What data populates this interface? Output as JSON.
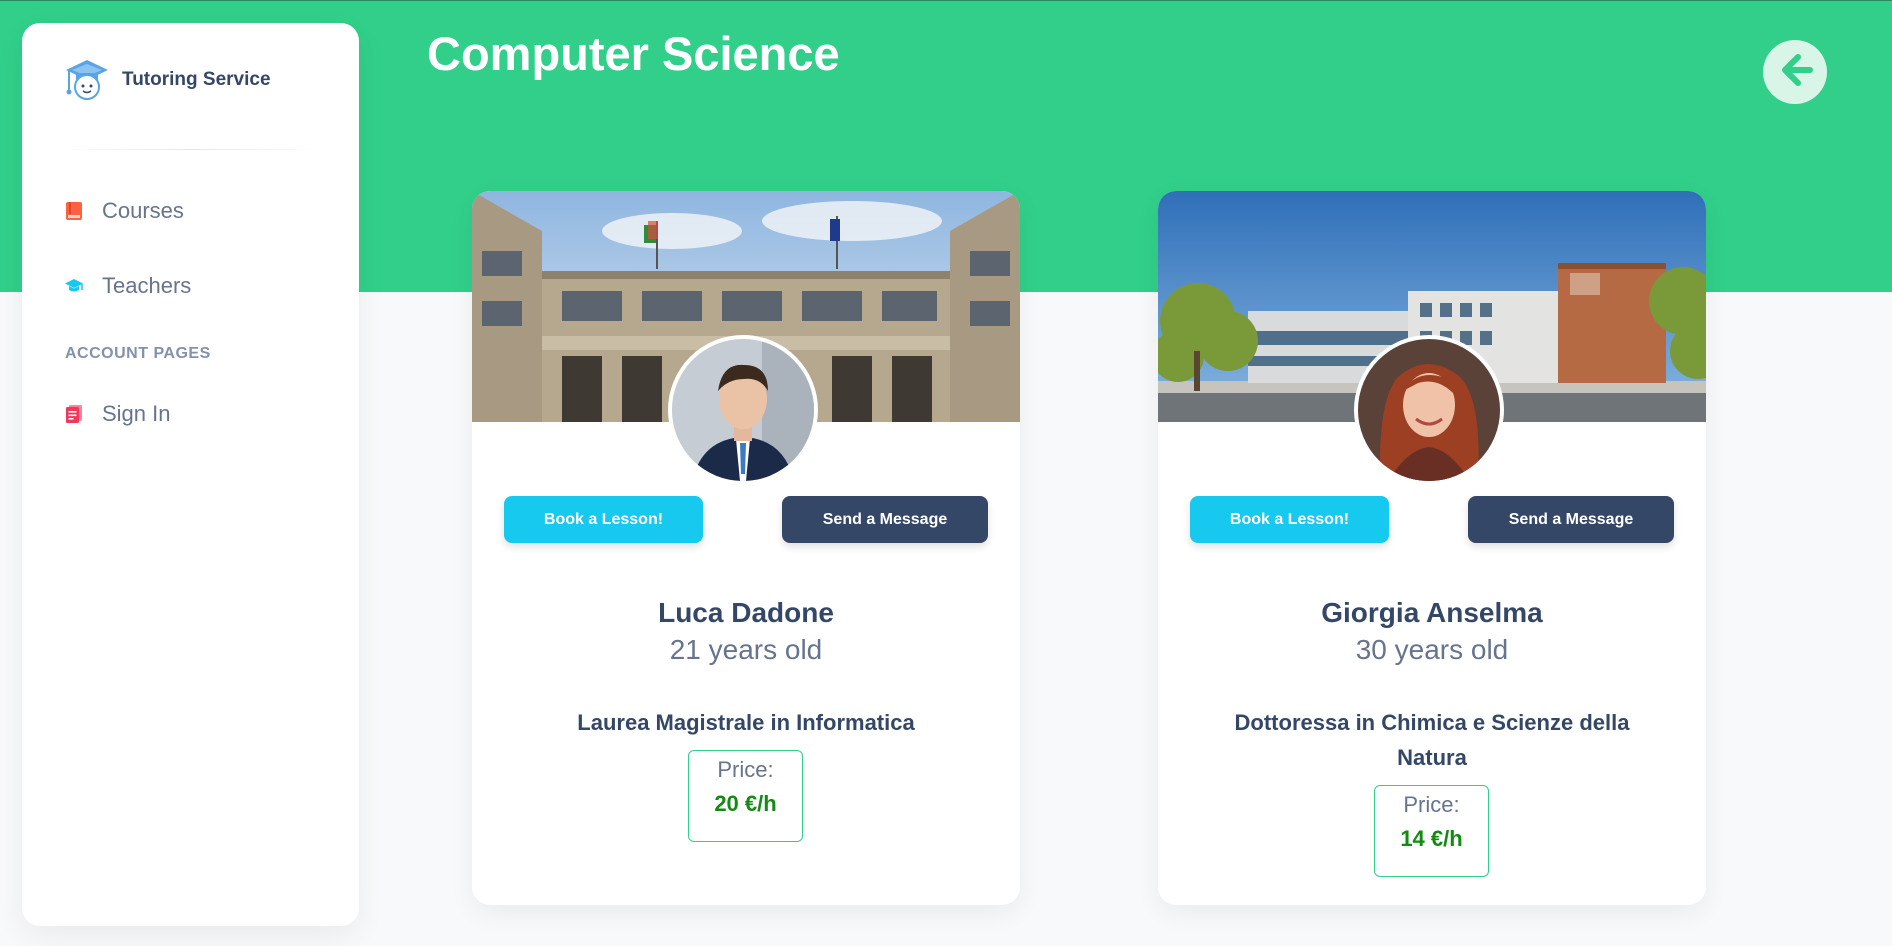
{
  "sidebar": {
    "brand_name": "Tutoring Service",
    "brand_icon": "graduation-cap-icon",
    "items": [
      {
        "label": "Courses",
        "icon": "book-icon",
        "color": "#fb6340"
      },
      {
        "label": "Teachers",
        "icon": "graduation-cap-icon",
        "color": "#17c9ef"
      },
      {
        "label": "Sign In",
        "icon": "document-icon",
        "color": "#f5365c"
      }
    ],
    "section_title": "ACCOUNT PAGES"
  },
  "header": {
    "title": "Computer Science",
    "back_icon": "arrow-left-icon"
  },
  "colors": {
    "accent": "#31cf8a",
    "primary_button": "#17c9ef",
    "dark_button": "#344767",
    "price": "#138a13"
  },
  "cards": [
    {
      "book_label": "Book a Lesson!",
      "message_label": "Send a Message",
      "name": "Luca Dadone",
      "age": "21 years old",
      "degree": "Laurea Magistrale in Informatica",
      "price_label": "Price:",
      "price": "20 €/h"
    },
    {
      "book_label": "Book a Lesson!",
      "message_label": "Send a Message",
      "name": "Giorgia Anselma",
      "age": "30 years old",
      "degree": "Dottoressa in Chimica e Scienze della Natura",
      "price_label": "Price:",
      "price": "14 €/h"
    }
  ]
}
